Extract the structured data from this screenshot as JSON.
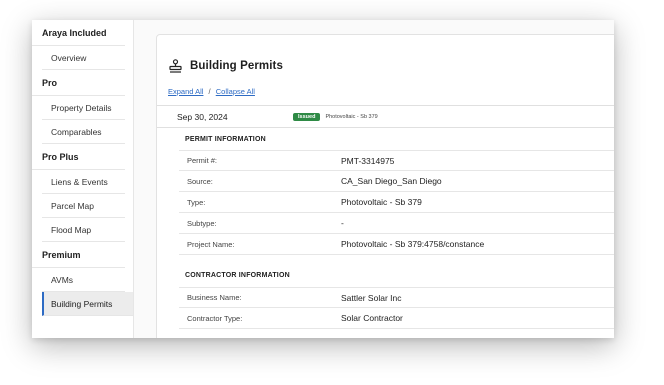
{
  "sidebar": {
    "sections": [
      {
        "title": "Araya Included",
        "items": [
          "Overview"
        ]
      },
      {
        "title": "Pro",
        "items": [
          "Property Details",
          "Comparables"
        ]
      },
      {
        "title": "Pro Plus",
        "items": [
          "Liens & Events",
          "Parcel Map",
          "Flood Map"
        ]
      },
      {
        "title": "Premium",
        "items": [
          "AVMs",
          "Building Permits"
        ]
      }
    ],
    "active_item": "Building Permits"
  },
  "card": {
    "title": "Building Permits",
    "icon": "stamp-icon",
    "expand_all": "Expand All",
    "separator": "/",
    "collapse_all": "Collapse All"
  },
  "permit": {
    "date": "Sep 30, 2024",
    "status": "Issued",
    "status_color": "#2e8a45",
    "summary": "Photovoltaic - Sb 379",
    "permit_info_label": "PERMIT INFORMATION",
    "fields": [
      {
        "label": "Permit #:",
        "value": "PMT-3314975"
      },
      {
        "label": "Source:",
        "value": "CA_San Diego_San Diego"
      },
      {
        "label": "Type:",
        "value": "Photovoltaic - Sb 379"
      },
      {
        "label": "Subtype:",
        "value": "-"
      },
      {
        "label": "Project Name:",
        "value": "Photovoltaic - Sb 379:4758/constance"
      }
    ],
    "contractor_info_label": "CONTRACTOR INFORMATION",
    "contractor_fields": [
      {
        "label": "Business Name:",
        "value": "Sattler Solar Inc"
      },
      {
        "label": "Contractor Type:",
        "value": "Solar Contractor"
      }
    ]
  },
  "colors": {
    "accent": "#2d6bc4",
    "active_bg": "#ececec"
  }
}
